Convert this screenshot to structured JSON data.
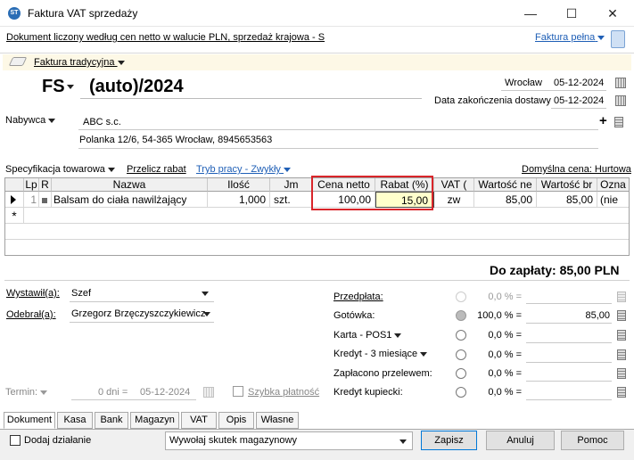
{
  "window": {
    "title": "Faktura VAT sprzedaży",
    "icon_name": "comarch-logo-icon",
    "logo_text": "ST"
  },
  "info": {
    "text": "Dokument liczony według cen netto w walucie PLN, sprzedaż krajowa - S",
    "faktura_link": "Faktura pełna"
  },
  "doc": {
    "type_label": "Faktura tradycyjna",
    "series": "FS",
    "number": "(auto)/2024",
    "city": "Wrocław",
    "issue_date": "05-12-2024",
    "delivery_label": "Data zakończenia dostawy",
    "delivery_date": "05-12-2024"
  },
  "buyer": {
    "label": "Nabywca",
    "name": "ABC s.c.",
    "address": "Polanka 12/6, 54-365 Wrocław, 8945653563"
  },
  "spec": {
    "spec_label": "Specyfikacja towarowa",
    "recalc_label": "Przelicz rabat",
    "mode_label": "Tryb pracy - Zwykły",
    "default_price": "Domyślna cena: Hurtowa"
  },
  "table": {
    "headers": [
      "Lp",
      "R",
      "Nazwa",
      "Ilość",
      "Jm",
      "Cena netto",
      "Rabat (%)",
      "VAT (",
      "Wartość ne",
      "Wartość br",
      "Ozna"
    ],
    "row": {
      "lp": "1",
      "name": "Balsam do ciała nawilżający",
      "qty": "1,000",
      "unit": "szt.",
      "price": "100,00",
      "discount": "15,00",
      "vat": "zw",
      "net": "85,00",
      "gross": "85,00",
      "mark": "(nie"
    },
    "new_row_marker": "*"
  },
  "total": {
    "text": "Do zapłaty: 85,00 PLN"
  },
  "people": {
    "issued_label": "Wystawił(a):",
    "issued_value": "Szef",
    "received_label": "Odebrał(a):",
    "received_value": "Grzegorz Brzęczyszczykiewicz"
  },
  "term": {
    "label": "Termin:",
    "days": "0 dni =",
    "date": "05-12-2024",
    "quick_pay": "Szybka płatność"
  },
  "payments": [
    {
      "label": "Przedpłata:",
      "pct": "0,0 % =",
      "amount": ""
    },
    {
      "label": "Gotówka:",
      "pct": "100,0 % =",
      "amount": "85,00"
    },
    {
      "label": "Karta - POS1",
      "pct": "0,0 % =",
      "amount": ""
    },
    {
      "label": "Kredyt - 3 miesiące",
      "pct": "0,0 % =",
      "amount": ""
    },
    {
      "label": "Zapłacono przelewem:",
      "pct": "0,0 % =",
      "amount": ""
    },
    {
      "label": "Kredyt kupiecki:",
      "pct": "0,0 % =",
      "amount": ""
    }
  ],
  "tabs": [
    "Dokument",
    "Kasa",
    "Bank",
    "Magazyn",
    "VAT",
    "Opis",
    "Własne"
  ],
  "footer": {
    "add_action": "Dodaj działanie",
    "action_select": "Wywołaj skutek magazynowy",
    "save": "Zapisz",
    "cancel": "Anuluj",
    "help": "Pomoc"
  },
  "colors": {
    "highlight_red": "#d9252a",
    "link_blue": "#1f5fb6",
    "discount_cell": "#ffffcc"
  }
}
